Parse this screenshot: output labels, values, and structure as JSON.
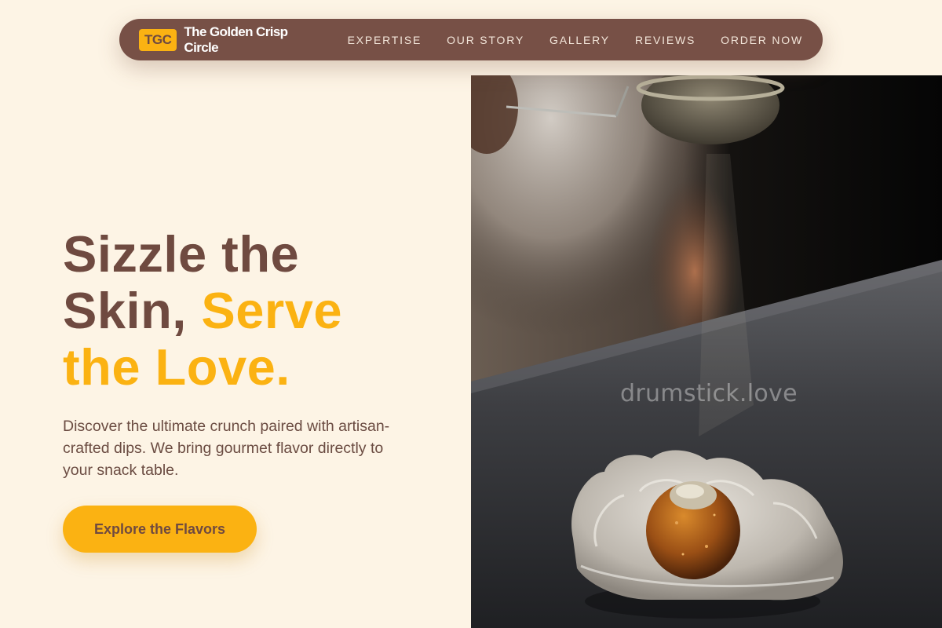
{
  "nav": {
    "logo_badge": "TGC",
    "brand_name": "The Golden Crisp Circle",
    "links": [
      "EXPERTISE",
      "OUR STORY",
      "GALLERY",
      "REVIEWS",
      "ORDER NOW"
    ]
  },
  "hero": {
    "title_line1": "Sizzle the",
    "title_line2_plain": "Skin, ",
    "title_line2_accent": "Serve",
    "title_line3_accent": "the Love.",
    "description": "Discover the ultimate crunch paired with artisan-crafted dips. We bring gourmet flavor directly to your snack table.",
    "cta_label": "Explore the Flavors",
    "image_watermark": "drumstick.love"
  },
  "colors": {
    "background": "#fdf4e5",
    "nav_background": "#775046",
    "brand_brown": "#6f4a40",
    "accent_gold": "#fbb212",
    "nav_text": "#f3e6da"
  }
}
